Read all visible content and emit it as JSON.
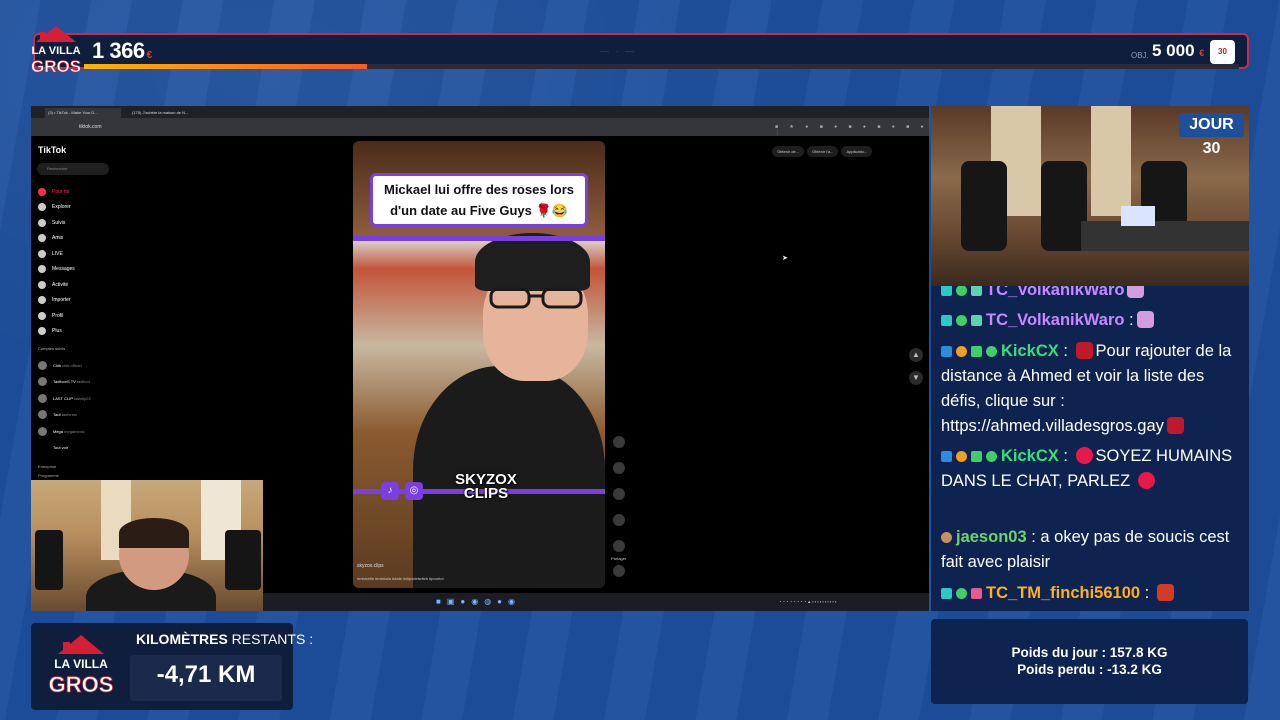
{
  "top_bar": {
    "brand_logo": "La Villa des Gros",
    "amount": "1 366",
    "amount_currency": "€",
    "progress_fraction": 0.245,
    "goal_label": "OBJ.",
    "goal_amount": "5 000",
    "goal_currency": "€",
    "badge_text": "30"
  },
  "browser": {
    "tabs": [
      "(3) • TikTok - Make Your D...",
      "(175) J'achète la maison de N..."
    ],
    "url": "tiktok.com",
    "toolbar_icons": [
      "extensions-icon",
      "bookmark-icon",
      "profile-icon",
      "menu-icon"
    ]
  },
  "tiktok": {
    "logo": "TikTok",
    "search_placeholder": "Rechercher",
    "nav": [
      "Pour toi",
      "Explorer",
      "Suivis",
      "Amis",
      "LIVE",
      "Messages",
      "Activité",
      "Importer",
      "Profil",
      "Plus"
    ],
    "following_header": "Comptes suivis",
    "following": [
      {
        "name": "Chik",
        "handle": "chik.officiel"
      },
      {
        "name": "TaxfloorS TV",
        "handle": "taxfloor"
      },
      {
        "name": "LAST CLIP",
        "handle": "lastclip22"
      },
      {
        "name": "Tauf",
        "handle": "taufcrew"
      },
      {
        "name": "Méga",
        "handle": "megamexic"
      }
    ],
    "see_all": "Tout voir",
    "footer": [
      "Entreprise",
      "Programme"
    ],
    "get_app": [
      "Obtenir de...",
      "Obtenir l'a...",
      "Applicatio..."
    ],
    "video": {
      "caption": "Mickael lui offre des roses lors d'un date au Five Guys 🌹😂",
      "watermark": "SKYZOX CLIPS",
      "username": "skyzox.clips",
      "hashtags": "#mickelfa #micksfa #date #clipsdetwitch #pourtoi"
    },
    "actions": [
      "like-icon",
      "comment-icon",
      "bookmark-icon",
      "share-icon"
    ],
    "share_label": "Partager"
  },
  "webcam": {
    "day_label": "JOUR 30"
  },
  "chat": {
    "messages": [
      {
        "user": "TC_VolkanikWaro",
        "color": "#c58aff",
        "text": ""
      },
      {
        "user": "TC_VolkanikWaro",
        "color": "#c58aff",
        "text": ""
      },
      {
        "user": "KickCX",
        "color": "#35e07a",
        "text": "Pour rajouter de la distance à Ahmed et voir la liste des défis, clique sur : https://ahmed.villadesgros.gay"
      },
      {
        "user": "KickCX",
        "color": "#35e07a",
        "text": "SOYEZ HUMAINS DANS LE CHAT, PARLEZ"
      },
      {
        "user": "jaeson03",
        "color": "#6fd36f",
        "text": "a okey pas de soucis cest fait avec plaisir"
      },
      {
        "user": "TC_TM_finchi56100",
        "color": "#ffb020",
        "text": ""
      }
    ]
  },
  "bottom": {
    "km_label_bold": "KILOMÈTRES",
    "km_label_rest": "RESTANTS :",
    "km_value": "-4,71 KM",
    "weight_day": "Poids du jour : 157.8 KG",
    "weight_lost": "Poids perdu : -13.2 KG"
  },
  "colors": {
    "background": "#1d4f9d",
    "panel": "#0f1e3d",
    "accent_red": "#c62e4a",
    "progress_start": "#ffb400",
    "progress_end": "#ff5a1f",
    "tiktok_red": "#fe2c55",
    "purple": "#7b3fe0"
  }
}
